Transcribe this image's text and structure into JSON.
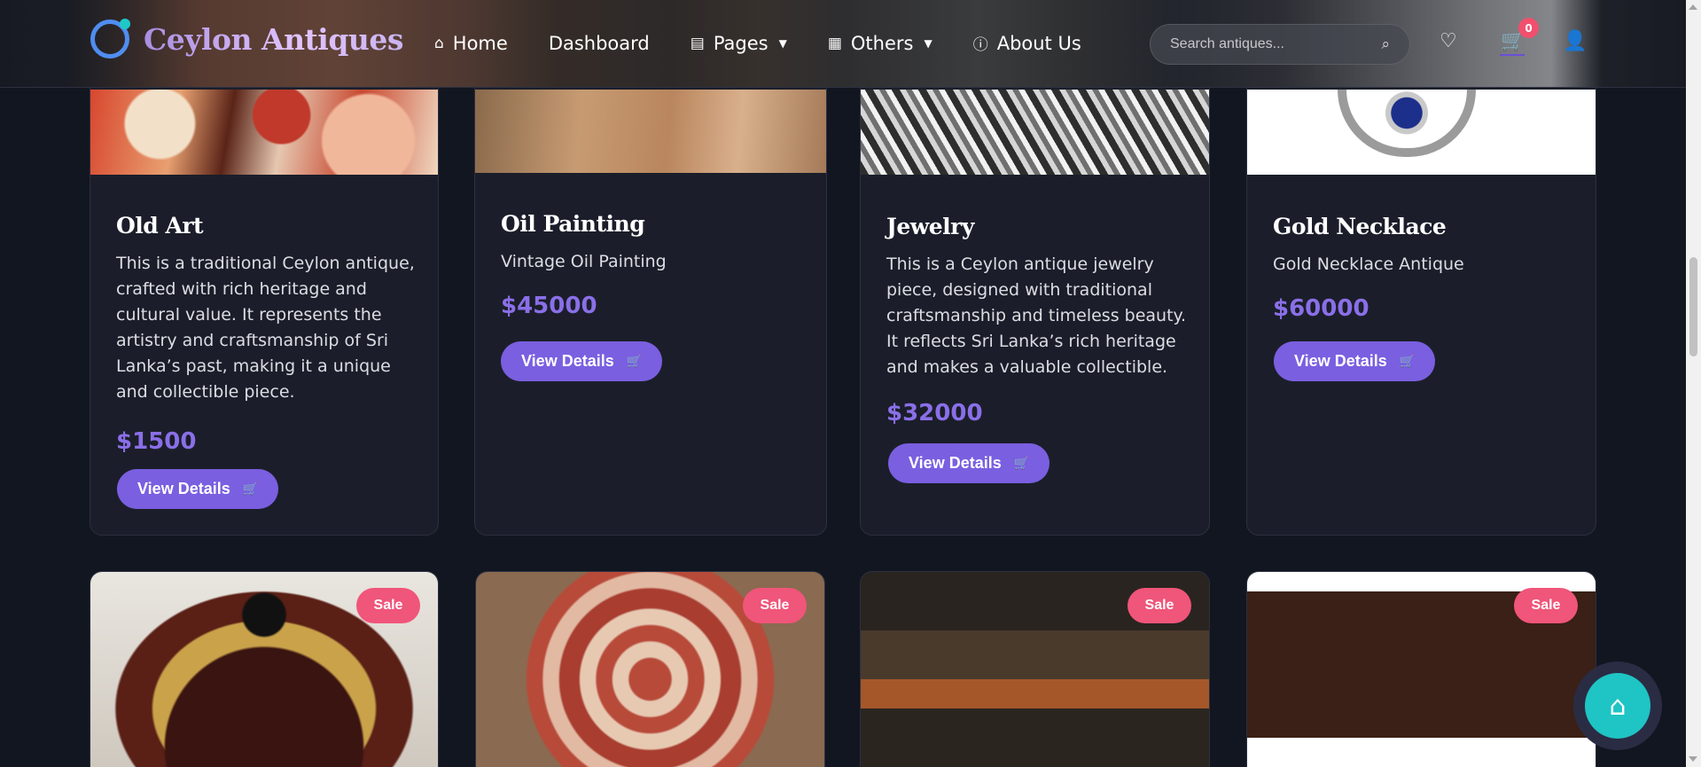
{
  "brand": {
    "name": "Ceylon Antiques"
  },
  "nav": {
    "items": [
      {
        "label": "Home",
        "icon": "home-icon"
      },
      {
        "label": "Dashboard",
        "icon": ""
      },
      {
        "label": "Pages",
        "icon": "document-icon"
      },
      {
        "label": "Others",
        "icon": "grid-icon"
      },
      {
        "label": "About Us",
        "icon": "info-icon"
      }
    ]
  },
  "search": {
    "placeholder": "Search antiques..."
  },
  "cart": {
    "count": "0"
  },
  "products": [
    {
      "title": "Old Art",
      "description": "This is a traditional Ceylon antique, crafted with rich heritage and cultural value. It represents the artistry and craftsmanship of Sri Lanka’s past, making it a unique and collectible piece.",
      "price": "$1500",
      "button": "View Details"
    },
    {
      "title": "Oil Painting",
      "description": "Vintage Oil Painting",
      "price": "$45000",
      "button": "View Details"
    },
    {
      "title": "Jewelry",
      "description": "This is a Ceylon antique jewelry piece, designed with traditional craftsmanship and timeless beauty. It reflects Sri Lanka’s rich heritage and makes a valuable collectible.",
      "price": "$32000",
      "button": "View Details"
    },
    {
      "title": "Gold Necklace",
      "description": "Gold Necklace Antique",
      "price": "$60000",
      "button": "View Details"
    }
  ],
  "sale_items": [
    {
      "badge": "Sale"
    },
    {
      "badge": "Sale"
    },
    {
      "badge": "Sale"
    },
    {
      "badge": "Sale"
    }
  ],
  "colors": {
    "accent": "#7a5fe0",
    "price": "#8a6fe8",
    "sale": "#f0557a",
    "fab": "#1fc4c4",
    "background": "#121620"
  }
}
